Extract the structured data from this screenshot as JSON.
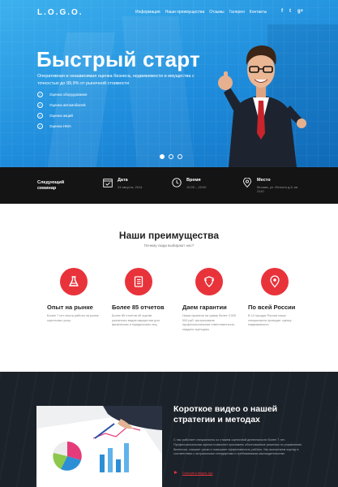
{
  "header": {
    "logo": "L.O.G.O.",
    "nav": [
      "Информация",
      "Наши преимущества",
      "Отзывы",
      "Галерея",
      "Контакты"
    ],
    "social": [
      "f",
      "t",
      "g+"
    ]
  },
  "hero": {
    "title": "Быстрый старт",
    "subtitle": "Оперативная и независимая оценка бизнеса, недвижимости и имущества с точностью до 99,9% от рыночной стоимости",
    "features": [
      "Оценка оборудования",
      "Оценка автомобилей",
      "Оценка акций",
      "Оценка НМА"
    ],
    "slides": 3,
    "active_slide": 0
  },
  "seminar": {
    "label": "Следующий семинар",
    "date_title": "Дата",
    "date_value": "24 августа, 2014",
    "time_title": "Время",
    "time_value": "10:00 – 15:00",
    "place_title": "Место",
    "place_value": "Москва, ул. Юности д.5, кв. 2110"
  },
  "advantages": {
    "title": "Наши преимущества",
    "subtitle": "Почему люди выбирают нас?",
    "items": [
      {
        "icon": "flask-icon",
        "title": "Опыт на рынке",
        "text": "Более 7 лет опыта работы на рынке оценочных услуг"
      },
      {
        "icon": "document-list-icon",
        "title": "Более 85 отчетов",
        "text": "Более 85 отчетов об оценке различных видов имущества для физических и юридических лиц"
      },
      {
        "icon": "shield-icon",
        "title": "Даем гарантии",
        "text": "Наша гарантия на сумму более 3 000 000 руб. застрахована профессиональная ответственность каждого оценщика"
      },
      {
        "icon": "map-pin-icon",
        "title": "По всей России",
        "text": "В 14 городах России наши специалисты проводят оценку недвижимости"
      }
    ]
  },
  "video": {
    "title": "Короткое видео о нашей стратегии и методах",
    "text": "С нас работает специалисты со стажем оценочной деятельности более 7 лет. Профессиональная оценка позволяет принимать обоснованные решения по управлению бизнесом, снижает риски и повышает эффективность работы. Мы выполняем оценку в соответствии с актуальными стандартами и требованиями законодательства.",
    "link": "Смотреть видео-тур"
  },
  "colors": {
    "accent": "#e8333b",
    "hero_blue": "#1f8ddc",
    "dark": "#141414"
  }
}
